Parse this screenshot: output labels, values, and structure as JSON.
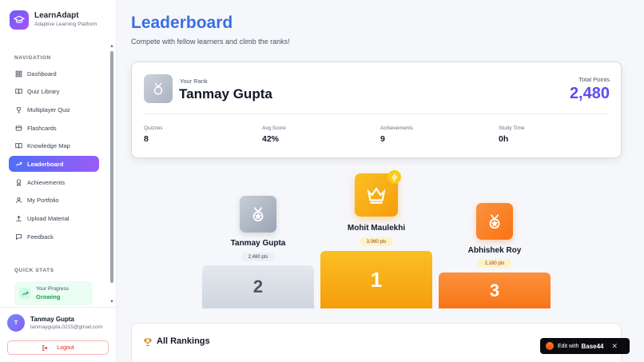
{
  "app": {
    "name": "LearnAdapt",
    "tagline": "Adaptive Learning Platform"
  },
  "sidebar": {
    "nav_label": "NAVIGATION",
    "items": [
      {
        "label": "Dashboard",
        "icon": "grid-icon"
      },
      {
        "label": "Quiz Library",
        "icon": "book-icon"
      },
      {
        "label": "Multiplayer Quiz",
        "icon": "trophy-icon"
      },
      {
        "label": "Flashcards",
        "icon": "card-icon"
      },
      {
        "label": "Knowledge Map",
        "icon": "map-icon"
      },
      {
        "label": "Leaderboard",
        "icon": "trend-icon",
        "active": true
      },
      {
        "label": "Achievements",
        "icon": "award-icon"
      },
      {
        "label": "My Portfolio",
        "icon": "user-icon"
      },
      {
        "label": "Upload Material",
        "icon": "upload-icon"
      },
      {
        "label": "Feedback",
        "icon": "message-icon"
      }
    ],
    "quick_stats_label": "QUICK STATS",
    "quick_stats": {
      "label": "Your Progress",
      "value": "Growing"
    },
    "user": {
      "initial": "T",
      "name": "Tanmay Gupta",
      "email": "tanmaygupta.0215@gmail.com"
    },
    "logout_label": "Logout"
  },
  "main": {
    "title": "Leaderboard",
    "subtitle": "Compete with fellow learners and climb the ranks!",
    "your_rank": {
      "label": "Your Rank",
      "name": "Tanmay Gupta",
      "total_label": "Total Points",
      "total_value": "2,480",
      "stats": [
        {
          "label": "Quizzes",
          "value": "8"
        },
        {
          "label": "Avg Score",
          "value": "42%"
        },
        {
          "label": "Achievements",
          "value": "9"
        },
        {
          "label": "Study Time",
          "value": "0h"
        }
      ]
    },
    "podium": {
      "second": {
        "name": "Tanmay Gupta",
        "points": "2,480 pts",
        "rank": "2"
      },
      "first": {
        "name": "Mohit Maulekhi",
        "points": "3,060 pts",
        "rank": "1"
      },
      "third": {
        "name": "Abhishek Roy",
        "points": "2,180 pts",
        "rank": "3"
      }
    },
    "all_rankings_title": "All Rankings"
  },
  "edit_badge": {
    "prefix": "Edit with",
    "brand": "Base44",
    "close": "✕"
  },
  "colors": {
    "accent_blue": "#3b6fe0",
    "points_purple": "#5b4ef0",
    "gold": "#f59e0b",
    "orange": "#f97316",
    "silver": "#aab3c0",
    "success": "#16a34a",
    "danger": "#dc2626"
  }
}
